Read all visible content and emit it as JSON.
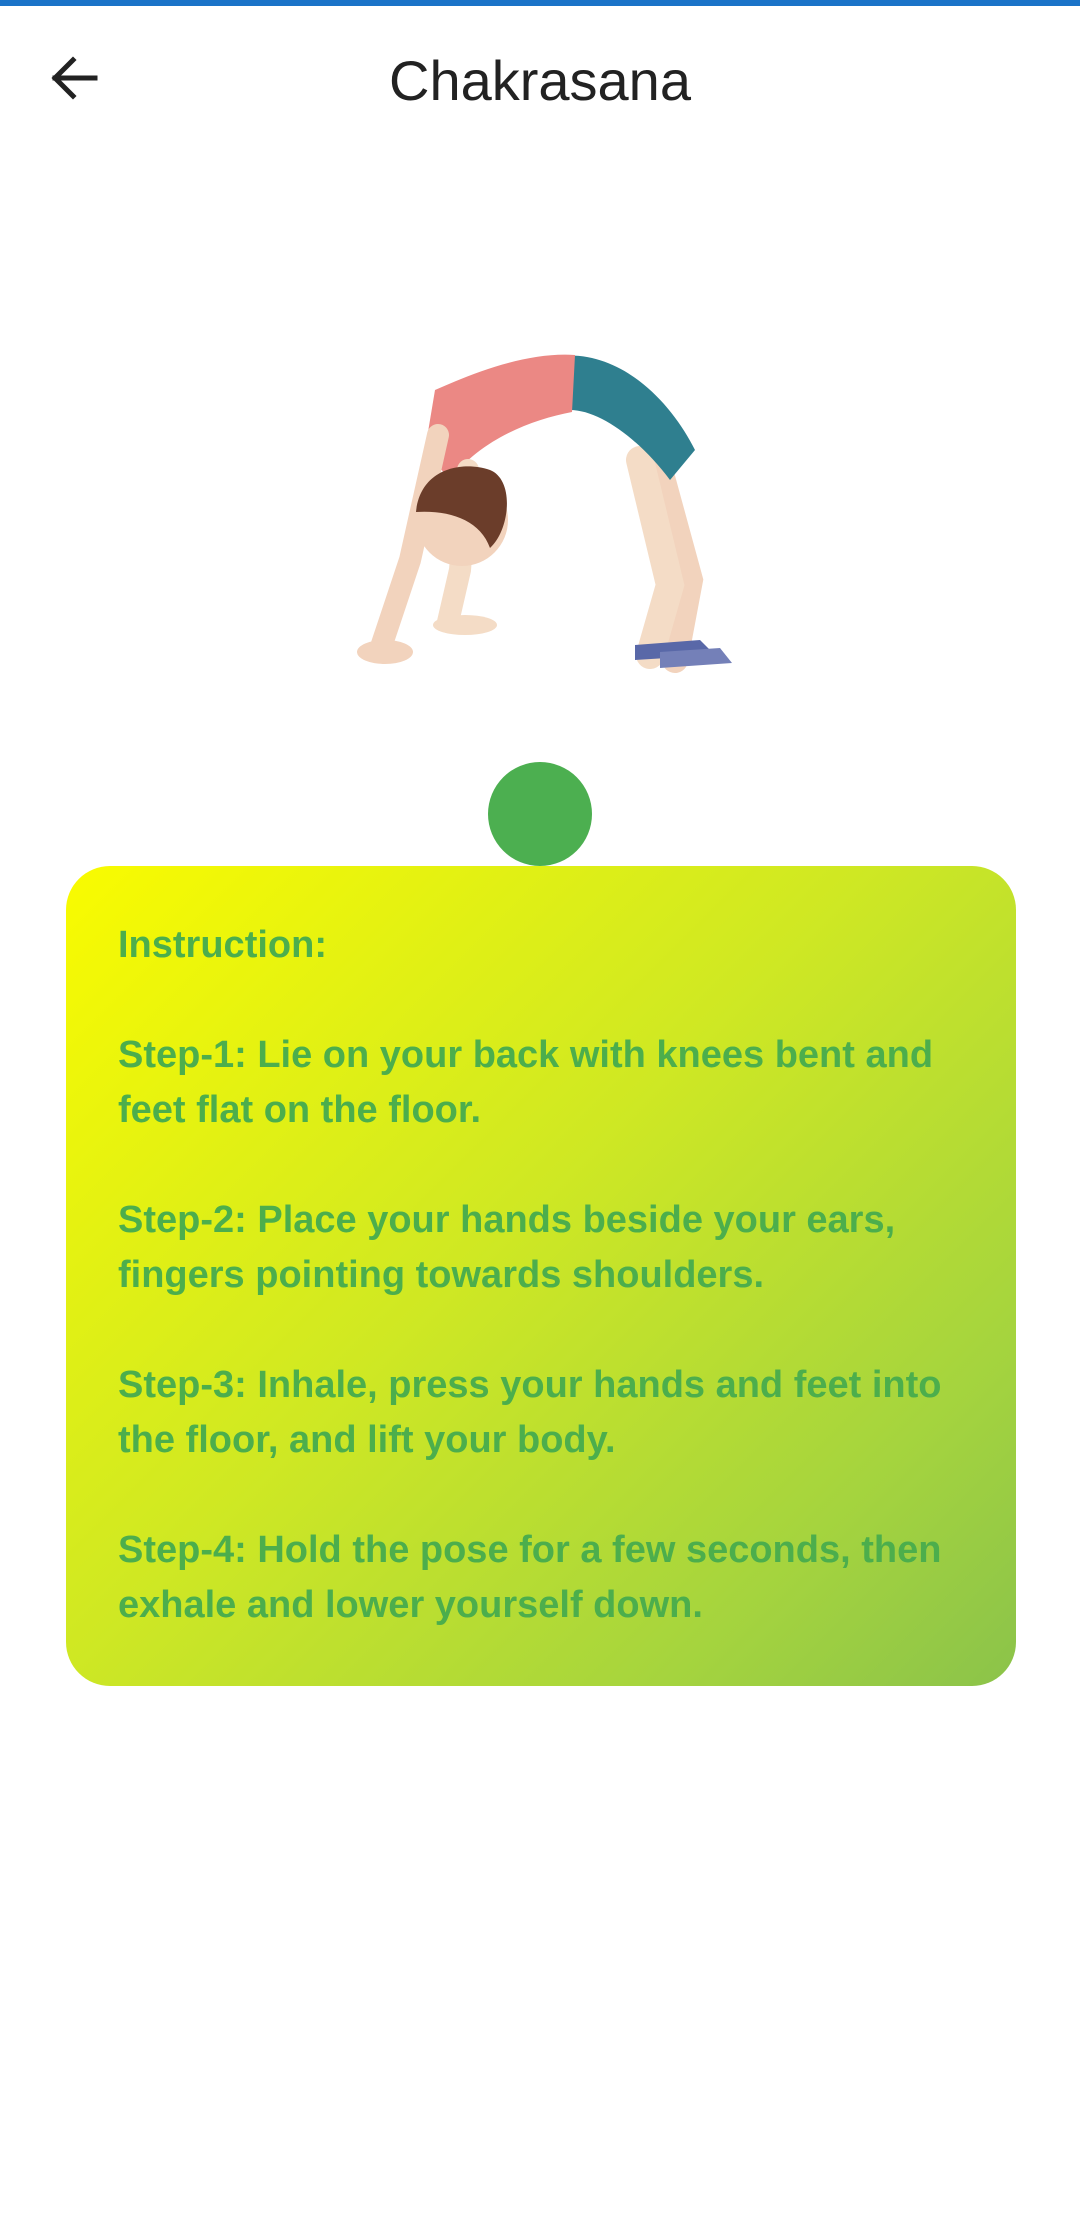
{
  "header": {
    "title": "Chakrasana"
  },
  "pose": {
    "image_alt": "Chakrasana wheel pose illustration"
  },
  "indicator": {
    "color": "#4caf50"
  },
  "instructions": {
    "heading": "Instruction:",
    "steps": [
      "Step-1: Lie on your back with knees bent and feet flat on the floor.",
      "Step-2: Place your hands beside your ears, fingers pointing towards shoulders.",
      "Step-3: Inhale, press your hands and feet into the floor, and lift your body.",
      "Step-4: Hold the pose for a few seconds, then exhale and lower yourself down."
    ]
  },
  "colors": {
    "accent_bar": "#1a73c8",
    "instruction_text": "#4cae4c",
    "card_gradient_start": "#f9fb00",
    "card_gradient_end": "#8bc34a"
  }
}
